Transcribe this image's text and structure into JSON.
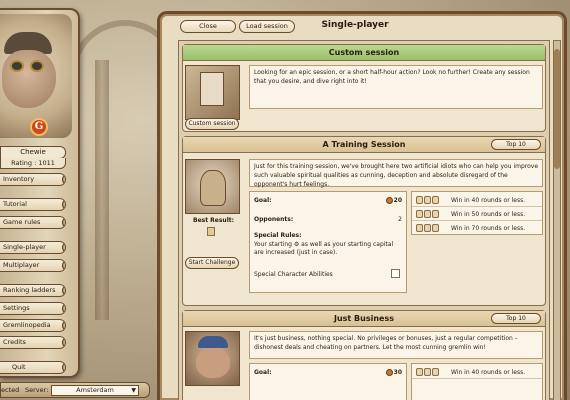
{
  "player": {
    "name": "Chewie",
    "rating": "Rating : 1011"
  },
  "sidebar": {
    "items": [
      {
        "label": "Inventory"
      },
      {
        "label": "Tutorial"
      },
      {
        "label": "Game rules"
      },
      {
        "label": "Single-player"
      },
      {
        "label": "Multiplayer"
      },
      {
        "label": "Ranking ladders"
      },
      {
        "label": "Settings"
      },
      {
        "label": "Gremlinopedia"
      },
      {
        "label": "Credits"
      },
      {
        "label": "Quit"
      }
    ]
  },
  "server_bar": {
    "connected_label": "ected",
    "server_label": "Server:",
    "server_value": "Amsterdam"
  },
  "panel": {
    "title": "Single-player",
    "close_label": "Close",
    "load_label": "Load session"
  },
  "custom": {
    "title": "Custom session",
    "description": "Looking for an epic session, or a short half-hour action? Look no further! Create any session that you desire, and dive right into it!",
    "button": "Custom session"
  },
  "training": {
    "title": "A Training Session",
    "top10": "Top 10",
    "description": "Just for this training session, we've brought here two artificial idiots who can help you improve such valuable spiritual qualities as cunning, deception and absolute disregard of the opponent's hurt feelings.",
    "goal_label": "Goal:",
    "goal_value": "20",
    "opponents_label": "Opponents:",
    "opponents_value": "2",
    "special_rules_label": "Special Rules:",
    "special_rules_text": "Your starting ⚙ as well as your starting capital are increased (just in case).",
    "special_abilities_label": "Special Character Abilities",
    "best_result_label": "Best Result:",
    "start_button": "Start Challenge",
    "wins": [
      {
        "text": "Win in 40 rounds or less."
      },
      {
        "text": "Win in 50 rounds or less."
      },
      {
        "text": "Win in 70 rounds or less."
      }
    ]
  },
  "business": {
    "title": "Just Business",
    "top10": "Top 10",
    "description": "It's just business, nothing special. No privileges or bonuses, just a regular competition – dishonest deals and cheating on partners. Let the most cunning gremlin win!",
    "goal_label": "Goal:",
    "goal_value": "30",
    "wins": [
      {
        "text": "Win in 40 rounds or less."
      }
    ]
  },
  "colors": {
    "panel_bg": "#e8dcc3",
    "border_brown": "#6a4b2e",
    "custom_header_green": "#a8cc7a",
    "card_header_tan": "#e0cba3"
  }
}
